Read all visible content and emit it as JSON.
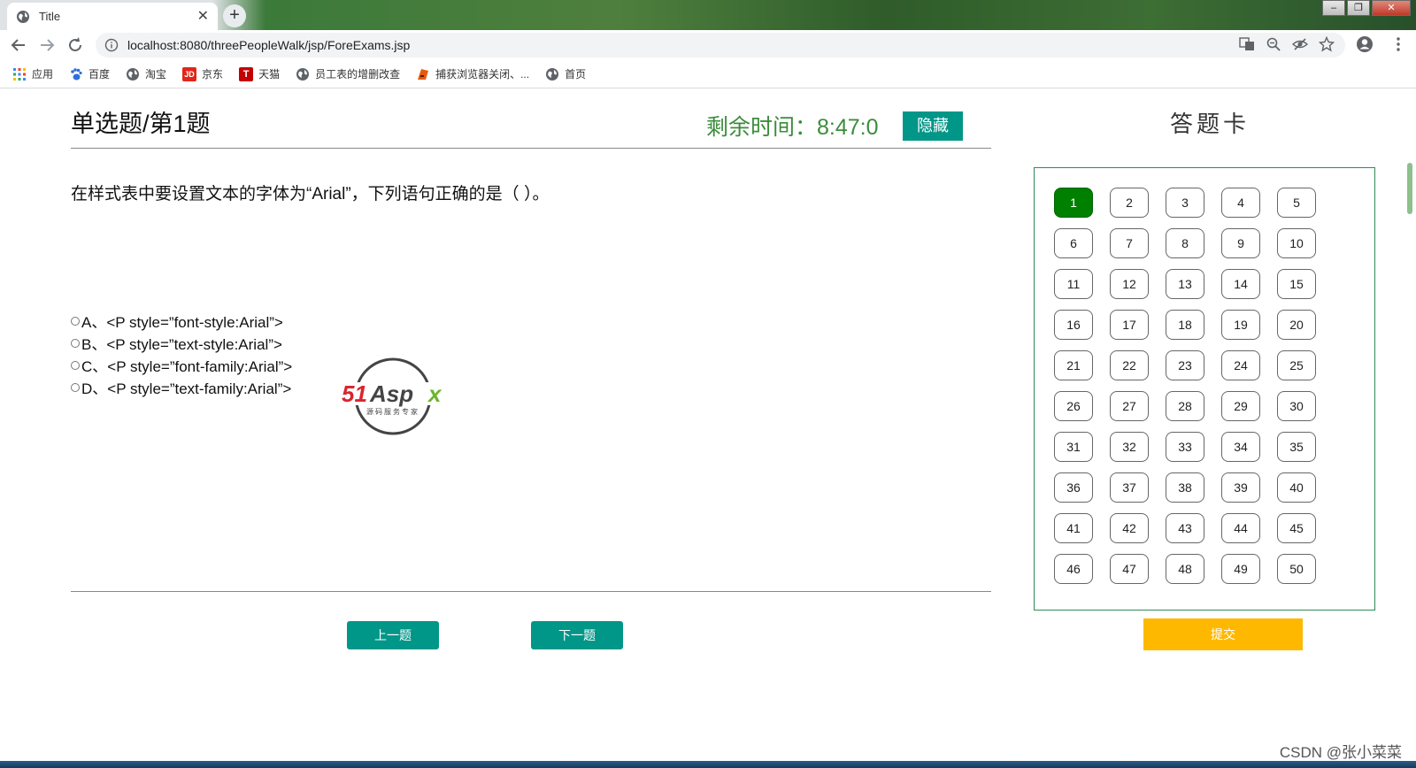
{
  "browser": {
    "tab_title": "Title",
    "new_tab_label": "+",
    "url": "localhost:8080/threePeopleWalk/jsp/ForeExams.jsp",
    "window_controls": [
      "–",
      "❐",
      "✕"
    ]
  },
  "bookmarks": [
    {
      "label": "应用",
      "icon": "apps-grid-icon"
    },
    {
      "label": "百度",
      "icon": "baidu-paw-icon"
    },
    {
      "label": "淘宝",
      "icon": "globe-icon"
    },
    {
      "label": "京东",
      "icon": "jd-icon",
      "badge": "JD"
    },
    {
      "label": "天猫",
      "icon": "tmall-icon",
      "badge": "T"
    },
    {
      "label": "员工表的增删改查",
      "icon": "globe-icon"
    },
    {
      "label": "捕获浏览器关闭、...",
      "icon": "jetbrains-icon"
    },
    {
      "label": "首页",
      "icon": "globe-icon"
    }
  ],
  "exam": {
    "title": "单选题/第1题",
    "timer": "剩余时间：8:47:0",
    "hide_label": "隐藏",
    "question": "在样式表中要设置文本的字体为“Arial”，下列语句正确的是（ ）。",
    "options": [
      "A、<P style=”font-style:Arial”>",
      "B、<P style=”text-style:Arial”>",
      "C、<P style=”font-family:Arial”>",
      "D、<P style=”text-family:Arial”>"
    ],
    "prev_label": "上一题",
    "next_label": "下一题"
  },
  "answer_card": {
    "title": "答题卡",
    "numbers": [
      "1",
      "2",
      "3",
      "4",
      "5",
      "6",
      "7",
      "8",
      "9",
      "10",
      "11",
      "12",
      "13",
      "14",
      "15",
      "16",
      "17",
      "18",
      "19",
      "20",
      "21",
      "22",
      "23",
      "24",
      "25",
      "26",
      "27",
      "28",
      "29",
      "30",
      "31",
      "32",
      "33",
      "34",
      "35",
      "36",
      "37",
      "38",
      "39",
      "40",
      "41",
      "42",
      "43",
      "44",
      "45",
      "46",
      "47",
      "48",
      "49",
      "50"
    ],
    "active_index": 0,
    "submit_label": "提交"
  },
  "logo": {
    "brand": "51Aspx",
    "tagline": "源码服务专家"
  },
  "watermark": "CSDN @张小菜菜",
  "colors": {
    "accent": "#009688",
    "active": "#008000",
    "timer": "#3c8c3c",
    "submit": "#FFB800",
    "card_border": "#2e8b57"
  }
}
